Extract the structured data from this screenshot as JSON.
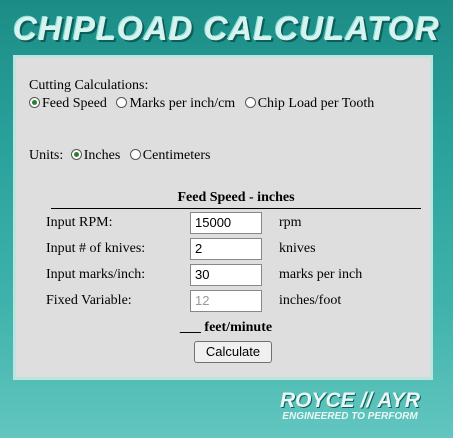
{
  "app_title": "CHIPLOAD CALCULATOR",
  "cutting": {
    "label": "Cutting Calculations:",
    "options": [
      "Feed Speed",
      "Marks per inch/cm",
      "Chip Load per Tooth"
    ],
    "selected_index": 0
  },
  "units": {
    "label": "Units:",
    "options": [
      "Inches",
      "Centimeters"
    ],
    "selected_index": 0
  },
  "section_title": "Feed Speed - inches",
  "fields": [
    {
      "label": "Input RPM:",
      "value": "15000",
      "unit": "rpm"
    },
    {
      "label": "Input # of knives:",
      "value": "2",
      "unit": "knives"
    },
    {
      "label": "Input marks/inch:",
      "value": "30",
      "unit": "marks per inch"
    },
    {
      "label": "Fixed Variable:",
      "value": "12",
      "unit": "inches/foot"
    }
  ],
  "result_text": "___ feet/minute",
  "calculate_label": "Calculate",
  "logo": {
    "brand": "ROYCE // AYR",
    "tagline": "ENGINEERED TO PERFORM"
  },
  "colors": {
    "background": "#2aa39c",
    "panel": "#dedede",
    "radio_checked": "#2e7d32"
  }
}
